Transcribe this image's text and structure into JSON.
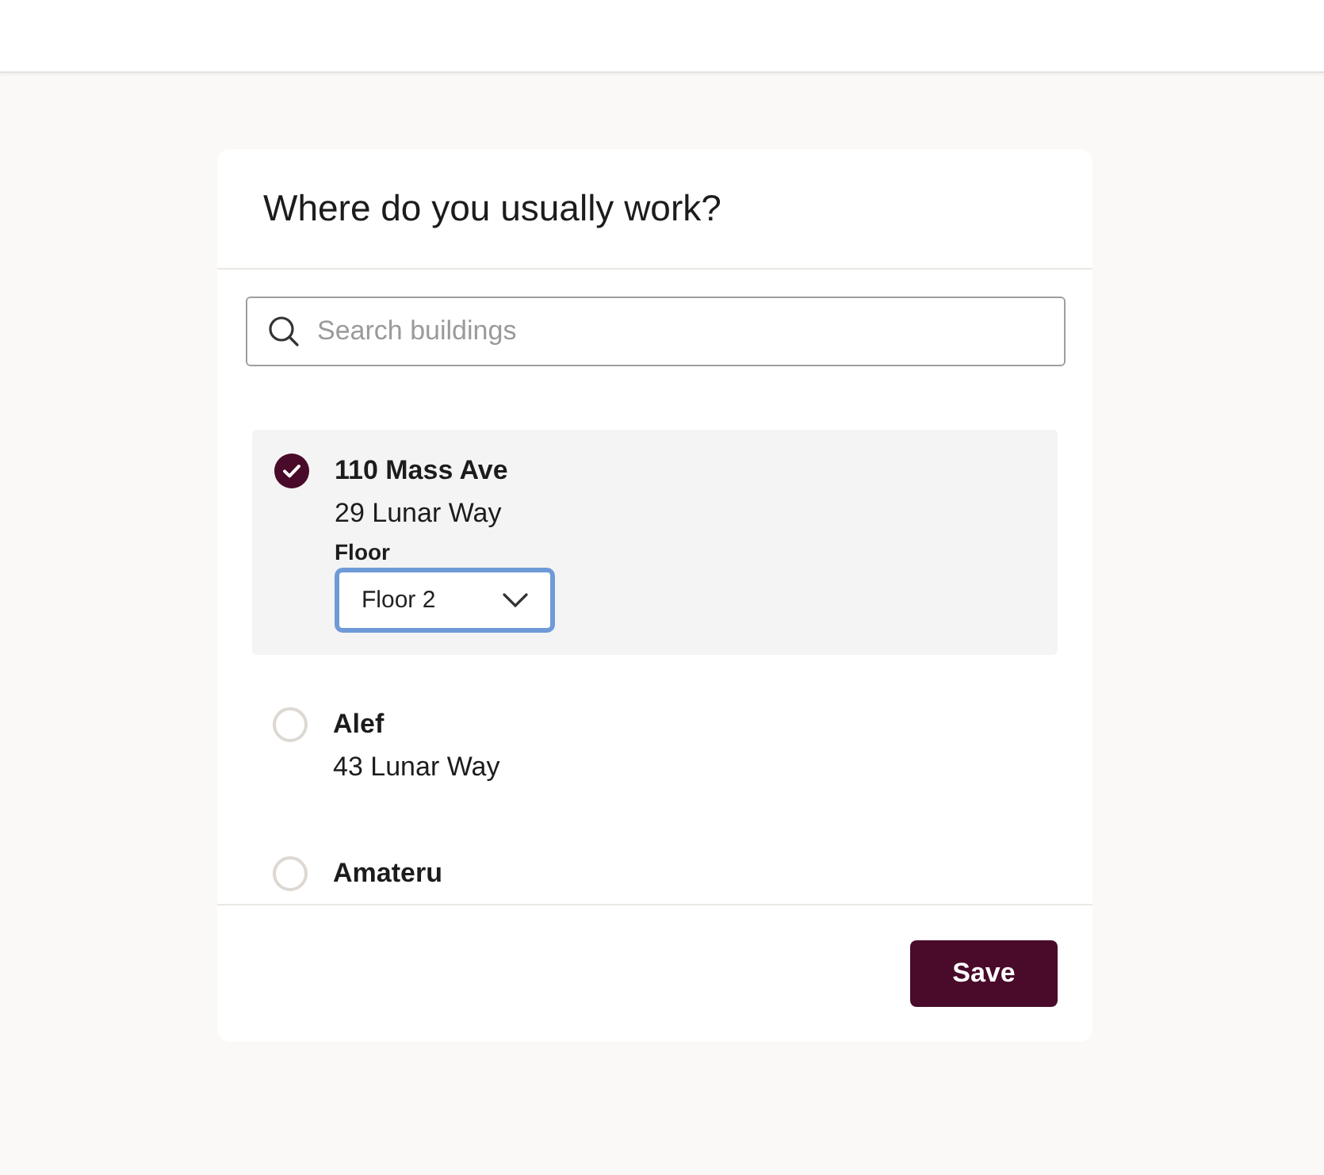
{
  "dialog": {
    "title": "Where do you usually work?",
    "search": {
      "placeholder": "Search buildings"
    },
    "buildings": [
      {
        "name": "110 Mass Ave",
        "address": "29 Lunar Way",
        "selected": true,
        "floor": {
          "label": "Floor",
          "value": "Floor 2"
        }
      },
      {
        "name": "Alef",
        "address": "43 Lunar Way",
        "selected": false
      },
      {
        "name": "Amateru",
        "selected": false
      }
    ],
    "buttons": [
      {
        "label": "Save"
      }
    ]
  }
}
